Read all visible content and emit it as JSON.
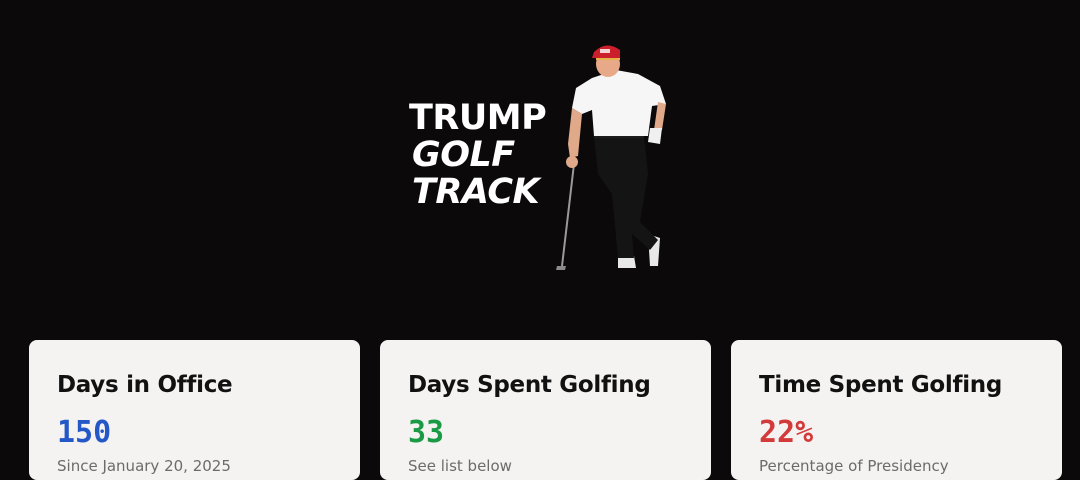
{
  "logo": {
    "line1": "TRUMP",
    "line2": "GOLF",
    "line3": "TRACK",
    "image": "golfer-figure-leaning-on-club"
  },
  "stats": [
    {
      "title": "Days in Office",
      "value": "150",
      "subtitle": "Since January 20, 2025",
      "color": "#2458c6"
    },
    {
      "title": "Days Spent Golfing",
      "value": "33",
      "subtitle": "See list below",
      "color": "#1b9a46"
    },
    {
      "title": "Time Spent Golfing",
      "value": "22%",
      "subtitle": "Percentage of Presidency",
      "color": "#d33a3a"
    }
  ],
  "colors": {
    "background": "#0b0909",
    "card": "#f4f3f2"
  }
}
